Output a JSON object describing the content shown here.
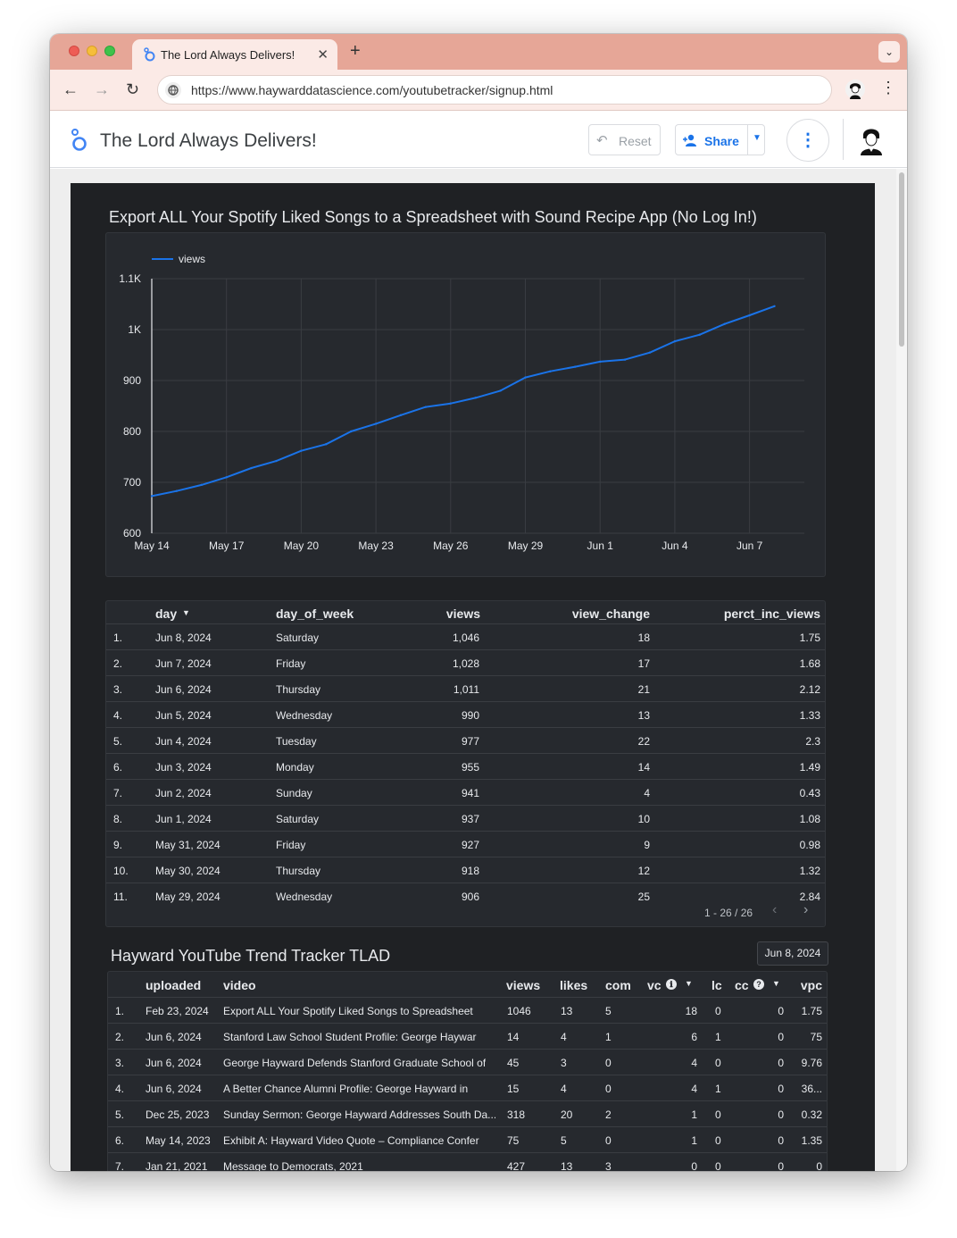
{
  "browser": {
    "tab_title": "The Lord Always Delivers!",
    "tab_close": "✕",
    "new_tab": "+",
    "tab_menu": "⌄",
    "url": "https://www.haywarddatascience.com/youtubetracker/signup.html",
    "back": "←",
    "forward": "→",
    "reload": "↻",
    "menu": "⋮"
  },
  "app": {
    "title": "The Lord Always Delivers!",
    "reset_icon": "↶",
    "reset_label": "Reset",
    "share_label": "Share",
    "share_dropdown": "▼",
    "more_icon": "⋮"
  },
  "chart_section": {
    "title": "Export ALL Your Spotify Liked Songs to a Spreadsheet with Sound Recipe App (No Log In!)"
  },
  "chart_data": {
    "type": "line",
    "legend": "views",
    "legend_position": "top-left",
    "series_color": "#1a73e8",
    "grid": true,
    "ylim": [
      600,
      1100
    ],
    "yticks": [
      "600",
      "700",
      "800",
      "900",
      "1K",
      "1.1K"
    ],
    "ytick_values": [
      600,
      700,
      800,
      900,
      1000,
      1100
    ],
    "xticks": [
      "May 14",
      "May 17",
      "May 20",
      "May 23",
      "May 26",
      "May 29",
      "Jun 1",
      "Jun 4",
      "Jun 7"
    ],
    "xtick_days": [
      0,
      3,
      6,
      9,
      12,
      15,
      18,
      21,
      24
    ],
    "x_days": [
      0,
      1,
      2,
      3,
      4,
      5,
      6,
      7,
      8,
      9,
      10,
      11,
      12,
      13,
      14,
      15,
      16,
      17,
      18,
      19,
      20,
      21,
      22,
      23,
      24,
      25
    ],
    "series": [
      {
        "name": "views",
        "values": [
          673,
          683,
          695,
          710,
          728,
          742,
          762,
          775,
          800,
          815,
          832,
          848,
          855,
          866,
          880,
          906,
          918,
          927,
          937,
          941,
          955,
          977,
          990,
          1011,
          1028,
          1046
        ]
      }
    ]
  },
  "table1": {
    "headers": {
      "day": "day",
      "sort": "▼",
      "day_of_week": "day_of_week",
      "views": "views",
      "view_change": "view_change",
      "perct_inc_views": "perct_inc_views"
    },
    "rows": [
      {
        "n": "1.",
        "day": "Jun 8, 2024",
        "dow": "Saturday",
        "views": "1,046",
        "change": "18",
        "pct": "1.75"
      },
      {
        "n": "2.",
        "day": "Jun 7, 2024",
        "dow": "Friday",
        "views": "1,028",
        "change": "17",
        "pct": "1.68"
      },
      {
        "n": "3.",
        "day": "Jun 6, 2024",
        "dow": "Thursday",
        "views": "1,011",
        "change": "21",
        "pct": "2.12"
      },
      {
        "n": "4.",
        "day": "Jun 5, 2024",
        "dow": "Wednesday",
        "views": "990",
        "change": "13",
        "pct": "1.33"
      },
      {
        "n": "5.",
        "day": "Jun 4, 2024",
        "dow": "Tuesday",
        "views": "977",
        "change": "22",
        "pct": "2.3"
      },
      {
        "n": "6.",
        "day": "Jun 3, 2024",
        "dow": "Monday",
        "views": "955",
        "change": "14",
        "pct": "1.49"
      },
      {
        "n": "7.",
        "day": "Jun 2, 2024",
        "dow": "Sunday",
        "views": "941",
        "change": "4",
        "pct": "0.43"
      },
      {
        "n": "8.",
        "day": "Jun 1, 2024",
        "dow": "Saturday",
        "views": "937",
        "change": "10",
        "pct": "1.08"
      },
      {
        "n": "9.",
        "day": "May 31, 2024",
        "dow": "Friday",
        "views": "927",
        "change": "9",
        "pct": "0.98"
      },
      {
        "n": "10.",
        "day": "May 30, 2024",
        "dow": "Thursday",
        "views": "918",
        "change": "12",
        "pct": "1.32"
      },
      {
        "n": "11.",
        "day": "May 29, 2024",
        "dow": "Wednesday",
        "views": "906",
        "change": "25",
        "pct": "2.84"
      }
    ],
    "pager": "1 - 26 / 26",
    "prev": "‹",
    "next": "›"
  },
  "section2": {
    "title": "Hayward YouTube Trend Tracker TLAD",
    "date": "Jun 8, 2024"
  },
  "table2": {
    "headers": {
      "uploaded": "uploaded",
      "video": "video",
      "views": "views",
      "likes": "likes",
      "com": "com",
      "vc": "vc",
      "vc_info": "ℹ",
      "vc_sort": "▼",
      "lc": "lc",
      "cc": "cc",
      "cc_help": "?",
      "cc_sort": "▼",
      "vpc": "vpc"
    },
    "rows": [
      {
        "n": "1.",
        "uploaded": "Feb 23, 2024",
        "video": "Export ALL Your Spotify Liked Songs to Spreadsheet",
        "views": "1046",
        "likes": "13",
        "com": "5",
        "vc": "18",
        "lc": "0",
        "cc": "0",
        "vpc": "1.75"
      },
      {
        "n": "2.",
        "uploaded": "Jun 6, 2024",
        "video": "Stanford Law School Student Profile: George Haywar",
        "views": "14",
        "likes": "4",
        "com": "1",
        "vc": "6",
        "lc": "1",
        "cc": "0",
        "vpc": "75"
      },
      {
        "n": "3.",
        "uploaded": "Jun 6, 2024",
        "video": "George Hayward Defends Stanford Graduate School of",
        "views": "45",
        "likes": "3",
        "com": "0",
        "vc": "4",
        "lc": "0",
        "cc": "0",
        "vpc": "9.76"
      },
      {
        "n": "4.",
        "uploaded": "Jun 6, 2024",
        "video": "A Better Chance Alumni Profile: George Hayward in",
        "views": "15",
        "likes": "4",
        "com": "0",
        "vc": "4",
        "lc": "1",
        "cc": "0",
        "vpc": "36..."
      },
      {
        "n": "5.",
        "uploaded": "Dec 25, 2023",
        "video": "Sunday Sermon: George Hayward Addresses South Da...",
        "views": "318",
        "likes": "20",
        "com": "2",
        "vc": "1",
        "lc": "0",
        "cc": "0",
        "vpc": "0.32"
      },
      {
        "n": "6.",
        "uploaded": "May 14, 2023",
        "video": "Exhibit A: Hayward Video Quote – Compliance Confer",
        "views": "75",
        "likes": "5",
        "com": "0",
        "vc": "1",
        "lc": "0",
        "cc": "0",
        "vpc": "1.35"
      },
      {
        "n": "7.",
        "uploaded": "Jan 21, 2021",
        "video": "Message to Democrats, 2021",
        "views": "427",
        "likes": "13",
        "com": "3",
        "vc": "0",
        "lc": "0",
        "cc": "0",
        "vpc": "0"
      }
    ]
  }
}
